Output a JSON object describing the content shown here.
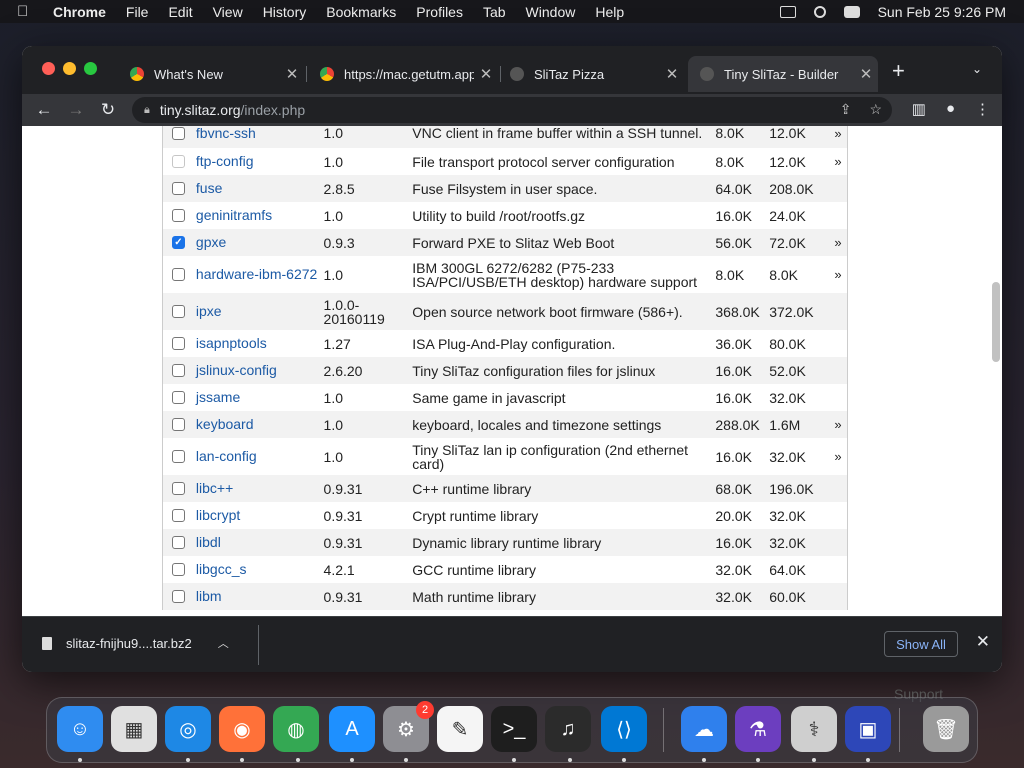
{
  "menubar": {
    "app": "Chrome",
    "items": [
      "File",
      "Edit",
      "View",
      "History",
      "Bookmarks",
      "Profiles",
      "Tab",
      "Window",
      "Help"
    ],
    "clock": "Sun Feb 25  9:26 PM"
  },
  "tabs": [
    {
      "title": "What's New",
      "icon": "chrome-icon",
      "active": false
    },
    {
      "title": "https://mac.getutm.app",
      "icon": "chrome-icon",
      "active": false
    },
    {
      "title": "SliTaz Pizza",
      "icon": "slitaz-icon",
      "active": false
    },
    {
      "title": "Tiny SliTaz - Builder",
      "icon": "slitaz-icon",
      "active": true
    }
  ],
  "omnibox": {
    "host": "tiny.slitaz.org",
    "path": "/index.php"
  },
  "packages": [
    {
      "name": "fbvnc-ssh",
      "version": "1.0",
      "description": "VNC client in frame buffer within a SSH tunnel.",
      "size": "8.0K",
      "installed": "12.0K",
      "more": "»",
      "checked": false,
      "disabled": false
    },
    {
      "name": "ftp-config",
      "version": "1.0",
      "description": "File transport protocol server configuration",
      "size": "8.0K",
      "installed": "12.0K",
      "more": "»",
      "checked": false,
      "disabled": true
    },
    {
      "name": "fuse",
      "version": "2.8.5",
      "description": "Fuse Filsystem in user space.",
      "size": "64.0K",
      "installed": "208.0K",
      "more": "",
      "checked": false,
      "disabled": false
    },
    {
      "name": "geninitramfs",
      "version": "1.0",
      "description": "Utility to build /root/rootfs.gz",
      "size": "16.0K",
      "installed": "24.0K",
      "more": "",
      "checked": false,
      "disabled": false
    },
    {
      "name": "gpxe",
      "version": "0.9.3",
      "description": "Forward PXE to Slitaz Web Boot",
      "size": "56.0K",
      "installed": "72.0K",
      "more": "»",
      "checked": true,
      "disabled": false
    },
    {
      "name": "hardware-ibm-6272",
      "version": "1.0",
      "description": "IBM 300GL 6272/6282 (P75-233 ISA/PCI/USB/ETH desktop) hardware support",
      "size": "8.0K",
      "installed": "8.0K",
      "more": "»",
      "checked": false,
      "disabled": false
    },
    {
      "name": "ipxe",
      "version": "1.0.0-20160119",
      "description": "Open source network boot firmware (586+).",
      "size": "368.0K",
      "installed": "372.0K",
      "more": "",
      "checked": false,
      "disabled": false
    },
    {
      "name": "isapnptools",
      "version": "1.27",
      "description": "ISA Plug-And-Play configuration.",
      "size": "36.0K",
      "installed": "80.0K",
      "more": "",
      "checked": false,
      "disabled": false
    },
    {
      "name": "jslinux-config",
      "version": "2.6.20",
      "description": "Tiny SliTaz configuration files for jslinux",
      "size": "16.0K",
      "installed": "52.0K",
      "more": "",
      "checked": false,
      "disabled": false
    },
    {
      "name": "jssame",
      "version": "1.0",
      "description": "Same game in javascript",
      "size": "16.0K",
      "installed": "32.0K",
      "more": "",
      "checked": false,
      "disabled": false
    },
    {
      "name": "keyboard",
      "version": "1.0",
      "description": "keyboard, locales and timezone settings",
      "size": "288.0K",
      "installed": "1.6M",
      "more": "»",
      "checked": false,
      "disabled": false
    },
    {
      "name": "lan-config",
      "version": "1.0",
      "description": "Tiny SliTaz lan ip configuration (2nd ethernet card)",
      "size": "16.0K",
      "installed": "32.0K",
      "more": "»",
      "checked": false,
      "disabled": false
    },
    {
      "name": "libc++",
      "version": "0.9.31",
      "description": "C++ runtime library",
      "size": "68.0K",
      "installed": "196.0K",
      "more": "",
      "checked": false,
      "disabled": false
    },
    {
      "name": "libcrypt",
      "version": "0.9.31",
      "description": "Crypt runtime library",
      "size": "20.0K",
      "installed": "32.0K",
      "more": "",
      "checked": false,
      "disabled": false
    },
    {
      "name": "libdl",
      "version": "0.9.31",
      "description": "Dynamic library runtime library",
      "size": "16.0K",
      "installed": "32.0K",
      "more": "",
      "checked": false,
      "disabled": false
    },
    {
      "name": "libgcc_s",
      "version": "4.2.1",
      "description": "GCC runtime library",
      "size": "32.0K",
      "installed": "64.0K",
      "more": "",
      "checked": false,
      "disabled": false
    },
    {
      "name": "libm",
      "version": "0.9.31",
      "description": "Math runtime library",
      "size": "32.0K",
      "installed": "60.0K",
      "more": "",
      "checked": false,
      "disabled": false
    }
  ],
  "download": {
    "filename": "slitaz-fnijhu9....tar.bz2",
    "show_all": "Show All"
  },
  "dock": {
    "apps": [
      {
        "name": "finder-icon",
        "color": "#2f8cf0"
      },
      {
        "name": "launchpad-icon",
        "color": "#e0e0e0"
      },
      {
        "name": "safari-icon",
        "color": "#1e88e5"
      },
      {
        "name": "firefox-icon",
        "color": "#ff7139"
      },
      {
        "name": "chrome-icon",
        "color": "#34a853"
      },
      {
        "name": "app-store-icon",
        "color": "#1e90ff"
      },
      {
        "name": "system-settings-icon",
        "color": "#8e8e93",
        "badge": "2"
      },
      {
        "name": "textedit-icon",
        "color": "#f5f5f5"
      },
      {
        "name": "terminal-icon",
        "color": "#1e1e1e"
      },
      {
        "name": "garageband-icon",
        "color": "#2b2b2b"
      },
      {
        "name": "vscode-icon",
        "color": "#0078d4"
      },
      {
        "name": "weather-icon",
        "color": "#2f80ed"
      },
      {
        "name": "xcode-icon",
        "color": "#6c3ebf"
      },
      {
        "name": "disk-utility-icon",
        "color": "#cfcfcf"
      },
      {
        "name": "utm-icon",
        "color": "#2d47b8"
      },
      {
        "name": "trash-icon",
        "color": "#9a9a9a"
      }
    ]
  },
  "background_text": "Support"
}
